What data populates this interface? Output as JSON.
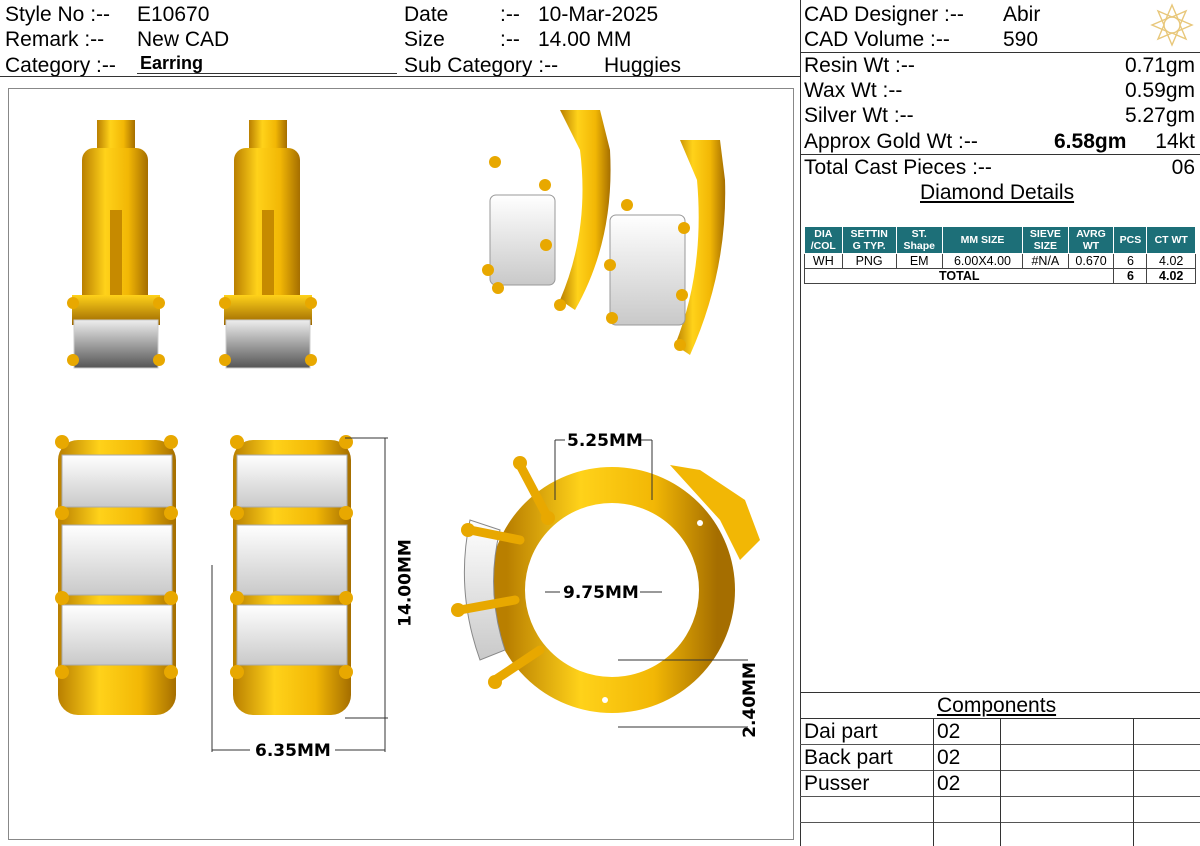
{
  "header": {
    "style_no_label": "Style No :--",
    "style_no": "E10670",
    "date_label": "Date",
    "date_sep": ":--",
    "date": "10-Mar-2025",
    "remark_label": "Remark :--",
    "remark": "New CAD",
    "size_label": "Size",
    "size_sep": ":--",
    "size": "14.00 MM",
    "category_label": "Category :--",
    "category": "Earring",
    "sub_category_label": "Sub Category :--",
    "sub_category": "Huggies"
  },
  "specs": {
    "cad_designer_label": "CAD  Designer :--",
    "cad_designer": "Abir",
    "cad_volume_label": "CAD   Volume  :--",
    "cad_volume": "590",
    "resin_label": "Resin Wt :--",
    "resin": "0.71gm",
    "wax_label": "Wax   Wt :--",
    "wax": "0.59gm",
    "silver_label": "Silver Wt :--",
    "silver": "5.27gm",
    "gold_label": "Approx Gold Wt :--",
    "gold": "6.58gm",
    "karat": "14kt",
    "cast_label": "Total Cast Pieces :--",
    "cast": "06"
  },
  "diamond": {
    "title": "Diamond Details",
    "headers": [
      [
        "DIA",
        "/COL"
      ],
      [
        "SETTIN",
        "G TYP."
      ],
      [
        "ST.",
        "Shape"
      ],
      [
        "MM SIZE"
      ],
      [
        "SIEVE",
        "SIZE"
      ],
      [
        "AVRG",
        "WT"
      ],
      [
        "PCS"
      ],
      [
        "CT WT"
      ]
    ],
    "row": [
      "WH",
      "PNG",
      "EM",
      "6.00X4.00",
      "#N/A",
      "0.670",
      "6",
      "4.02"
    ],
    "total_label": "TOTAL",
    "total_pcs": "6",
    "total_ct": "4.02"
  },
  "components": {
    "title": "Components",
    "items": [
      {
        "name": "Dai part",
        "qty": "02"
      },
      {
        "name": "Back part",
        "qty": "02"
      },
      {
        "name": "Pusser",
        "qty": "02"
      }
    ]
  },
  "dimensions": {
    "top_width": "5.25MM",
    "inner_diameter": "9.75MM",
    "thickness": "2.40MM",
    "height": "14.00MM",
    "width": "6.35MM"
  },
  "colors": {
    "gold": "#f2b705",
    "gold_dark": "#b97f00",
    "teal": "#1d6f78"
  }
}
